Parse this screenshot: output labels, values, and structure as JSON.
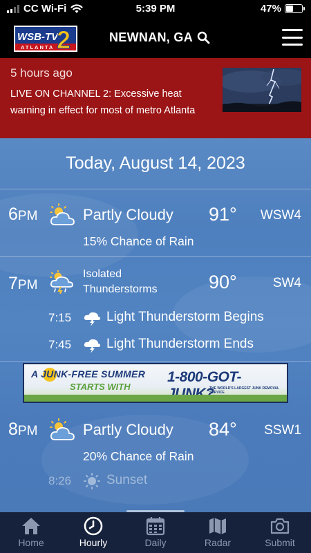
{
  "status_bar": {
    "carrier": "CC Wi-Fi",
    "time": "5:39 PM",
    "battery": "47%",
    "battery_level": 0.47
  },
  "header": {
    "logo_text": "WSB-TV",
    "logo_sub": "ATLANTA",
    "logo_numeral": "2",
    "location": "NEWNAN, GA"
  },
  "alert": {
    "age": "5 hours ago",
    "headline": "LIVE ON CHANNEL 2: Excessive heat warning in effect for most of metro Atlanta",
    "page_index": 1,
    "page_count": 2
  },
  "forecast": {
    "date": "Today, August 14, 2023",
    "hours": [
      {
        "hour": "6",
        "ampm": "PM",
        "icon": "partly-cloudy-icon",
        "condition": "Partly Cloudy",
        "temp": "91°",
        "wind": "WSW4",
        "detail": "15% Chance of Rain"
      },
      {
        "hour": "7",
        "ampm": "PM",
        "icon": "thunderstorm-icon",
        "condition_line1": "Isolated",
        "condition_line2": "Thunderstorms",
        "temp": "90°",
        "wind": "SW4",
        "events": [
          {
            "time": "7:15",
            "icon": "lightning-cloud-icon",
            "text": "Light Thunderstorm Begins"
          },
          {
            "time": "7:45",
            "icon": "lightning-cloud-icon",
            "text": "Light Thunderstorm Ends"
          }
        ]
      },
      {
        "hour": "8",
        "ampm": "PM",
        "icon": "partly-cloudy-icon",
        "condition": "Partly Cloudy",
        "temp": "84°",
        "wind": "SSW1",
        "detail": "20% Chance of Rain",
        "sun_event": {
          "time": "8:26",
          "icon": "sunset-icon",
          "text": "Sunset"
        }
      }
    ]
  },
  "ad": {
    "line1": "A JUNK-FREE SUMMER",
    "line2": "STARTS WITH",
    "phone": "1-800-GOT-JUNK?",
    "tagline": "THE WORLD'S LARGEST JUNK REMOVAL SERVICE"
  },
  "tabs": [
    {
      "label": "Home",
      "icon": "home-icon"
    },
    {
      "label": "Hourly",
      "icon": "clock-icon",
      "active": true
    },
    {
      "label": "Daily",
      "icon": "calendar-icon"
    },
    {
      "label": "Radar",
      "icon": "map-icon"
    },
    {
      "label": "Submit",
      "icon": "camera-icon"
    }
  ],
  "colors": {
    "alert_bg": "#9b1416",
    "tabbar_bg": "#16223c",
    "sky": "#5284c2"
  }
}
